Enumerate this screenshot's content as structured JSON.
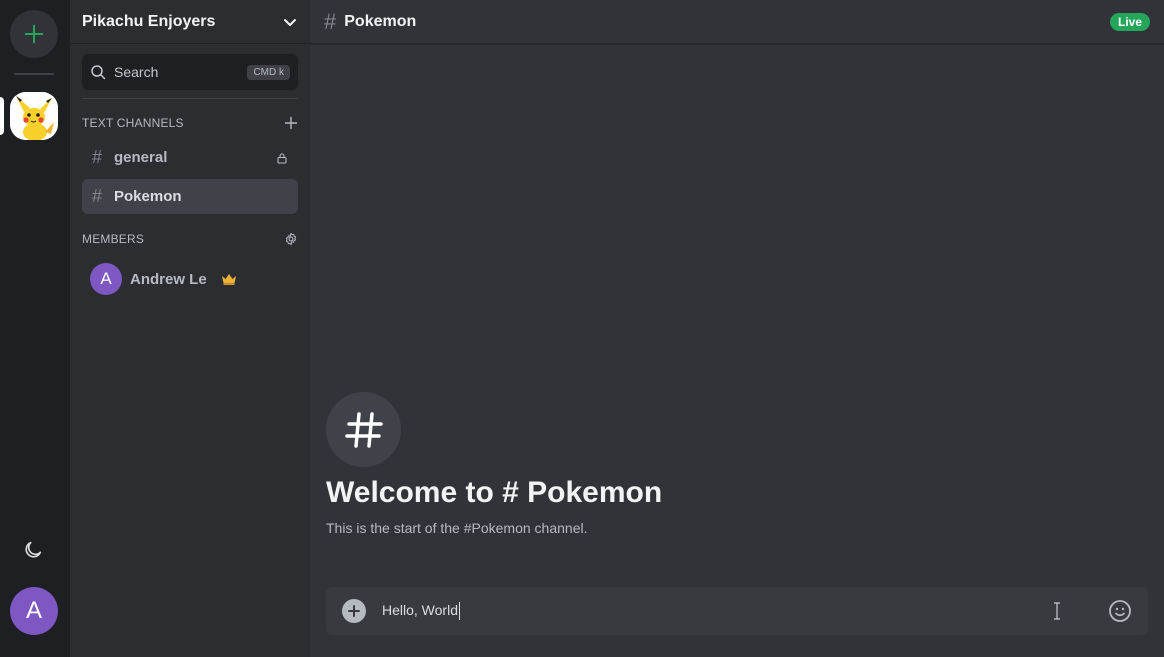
{
  "server": {
    "name": "Pikachu Enjoyers",
    "icon": "pikachu-server-icon"
  },
  "search": {
    "label": "Search",
    "shortcut": "CMD k"
  },
  "text_channels": {
    "title": "TEXT CHANNELS",
    "items": [
      {
        "label": "general",
        "locked": true,
        "active": false
      },
      {
        "label": "Pokemon",
        "locked": false,
        "active": true
      }
    ]
  },
  "members": {
    "title": "MEMBERS",
    "items": [
      {
        "initial": "A",
        "name": "Andrew Le",
        "role": "crown-icon"
      }
    ]
  },
  "rail": {
    "user_initial": "A"
  },
  "main": {
    "channel": "Pokemon",
    "status": "Live",
    "welcome_title": "Welcome to # Pokemon",
    "welcome_sub": "This is the start of the #Pokemon channel.",
    "composer_value": "Hello, World"
  },
  "colors": {
    "accent_green": "#23a55a",
    "avatar_purple": "#7e57c2",
    "crown_gold": "#f0b232"
  }
}
